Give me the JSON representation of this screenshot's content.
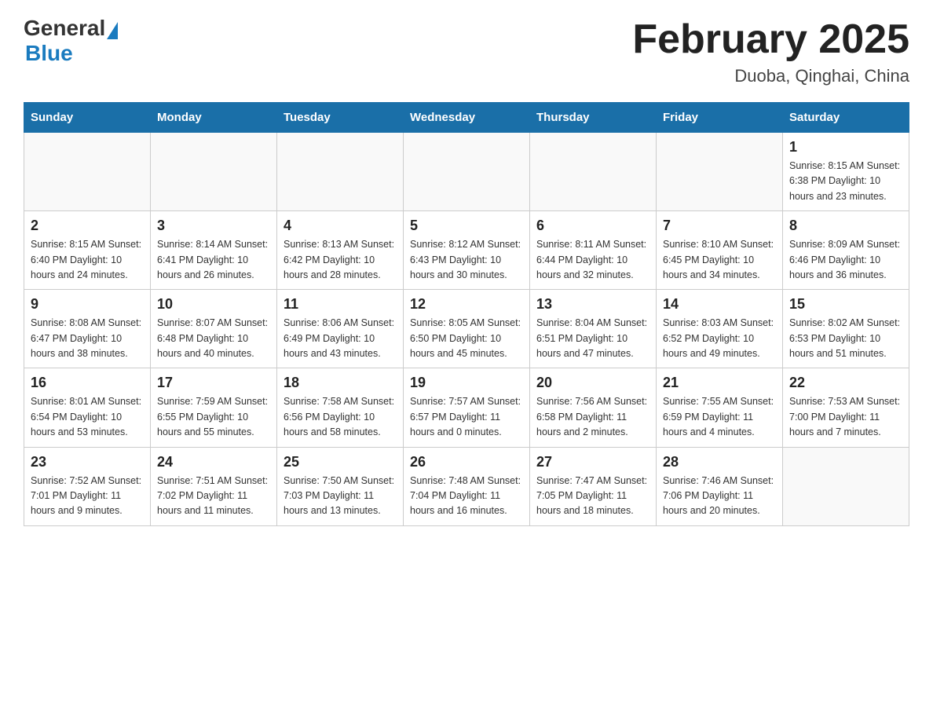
{
  "header": {
    "logo_general": "General",
    "logo_blue": "Blue",
    "month_title": "February 2025",
    "location": "Duoba, Qinghai, China"
  },
  "weekdays": [
    "Sunday",
    "Monday",
    "Tuesday",
    "Wednesday",
    "Thursday",
    "Friday",
    "Saturday"
  ],
  "weeks": [
    [
      {
        "day": "",
        "info": ""
      },
      {
        "day": "",
        "info": ""
      },
      {
        "day": "",
        "info": ""
      },
      {
        "day": "",
        "info": ""
      },
      {
        "day": "",
        "info": ""
      },
      {
        "day": "",
        "info": ""
      },
      {
        "day": "1",
        "info": "Sunrise: 8:15 AM\nSunset: 6:38 PM\nDaylight: 10 hours and 23 minutes."
      }
    ],
    [
      {
        "day": "2",
        "info": "Sunrise: 8:15 AM\nSunset: 6:40 PM\nDaylight: 10 hours and 24 minutes."
      },
      {
        "day": "3",
        "info": "Sunrise: 8:14 AM\nSunset: 6:41 PM\nDaylight: 10 hours and 26 minutes."
      },
      {
        "day": "4",
        "info": "Sunrise: 8:13 AM\nSunset: 6:42 PM\nDaylight: 10 hours and 28 minutes."
      },
      {
        "day": "5",
        "info": "Sunrise: 8:12 AM\nSunset: 6:43 PM\nDaylight: 10 hours and 30 minutes."
      },
      {
        "day": "6",
        "info": "Sunrise: 8:11 AM\nSunset: 6:44 PM\nDaylight: 10 hours and 32 minutes."
      },
      {
        "day": "7",
        "info": "Sunrise: 8:10 AM\nSunset: 6:45 PM\nDaylight: 10 hours and 34 minutes."
      },
      {
        "day": "8",
        "info": "Sunrise: 8:09 AM\nSunset: 6:46 PM\nDaylight: 10 hours and 36 minutes."
      }
    ],
    [
      {
        "day": "9",
        "info": "Sunrise: 8:08 AM\nSunset: 6:47 PM\nDaylight: 10 hours and 38 minutes."
      },
      {
        "day": "10",
        "info": "Sunrise: 8:07 AM\nSunset: 6:48 PM\nDaylight: 10 hours and 40 minutes."
      },
      {
        "day": "11",
        "info": "Sunrise: 8:06 AM\nSunset: 6:49 PM\nDaylight: 10 hours and 43 minutes."
      },
      {
        "day": "12",
        "info": "Sunrise: 8:05 AM\nSunset: 6:50 PM\nDaylight: 10 hours and 45 minutes."
      },
      {
        "day": "13",
        "info": "Sunrise: 8:04 AM\nSunset: 6:51 PM\nDaylight: 10 hours and 47 minutes."
      },
      {
        "day": "14",
        "info": "Sunrise: 8:03 AM\nSunset: 6:52 PM\nDaylight: 10 hours and 49 minutes."
      },
      {
        "day": "15",
        "info": "Sunrise: 8:02 AM\nSunset: 6:53 PM\nDaylight: 10 hours and 51 minutes."
      }
    ],
    [
      {
        "day": "16",
        "info": "Sunrise: 8:01 AM\nSunset: 6:54 PM\nDaylight: 10 hours and 53 minutes."
      },
      {
        "day": "17",
        "info": "Sunrise: 7:59 AM\nSunset: 6:55 PM\nDaylight: 10 hours and 55 minutes."
      },
      {
        "day": "18",
        "info": "Sunrise: 7:58 AM\nSunset: 6:56 PM\nDaylight: 10 hours and 58 minutes."
      },
      {
        "day": "19",
        "info": "Sunrise: 7:57 AM\nSunset: 6:57 PM\nDaylight: 11 hours and 0 minutes."
      },
      {
        "day": "20",
        "info": "Sunrise: 7:56 AM\nSunset: 6:58 PM\nDaylight: 11 hours and 2 minutes."
      },
      {
        "day": "21",
        "info": "Sunrise: 7:55 AM\nSunset: 6:59 PM\nDaylight: 11 hours and 4 minutes."
      },
      {
        "day": "22",
        "info": "Sunrise: 7:53 AM\nSunset: 7:00 PM\nDaylight: 11 hours and 7 minutes."
      }
    ],
    [
      {
        "day": "23",
        "info": "Sunrise: 7:52 AM\nSunset: 7:01 PM\nDaylight: 11 hours and 9 minutes."
      },
      {
        "day": "24",
        "info": "Sunrise: 7:51 AM\nSunset: 7:02 PM\nDaylight: 11 hours and 11 minutes."
      },
      {
        "day": "25",
        "info": "Sunrise: 7:50 AM\nSunset: 7:03 PM\nDaylight: 11 hours and 13 minutes."
      },
      {
        "day": "26",
        "info": "Sunrise: 7:48 AM\nSunset: 7:04 PM\nDaylight: 11 hours and 16 minutes."
      },
      {
        "day": "27",
        "info": "Sunrise: 7:47 AM\nSunset: 7:05 PM\nDaylight: 11 hours and 18 minutes."
      },
      {
        "day": "28",
        "info": "Sunrise: 7:46 AM\nSunset: 7:06 PM\nDaylight: 11 hours and 20 minutes."
      },
      {
        "day": "",
        "info": ""
      }
    ]
  ]
}
